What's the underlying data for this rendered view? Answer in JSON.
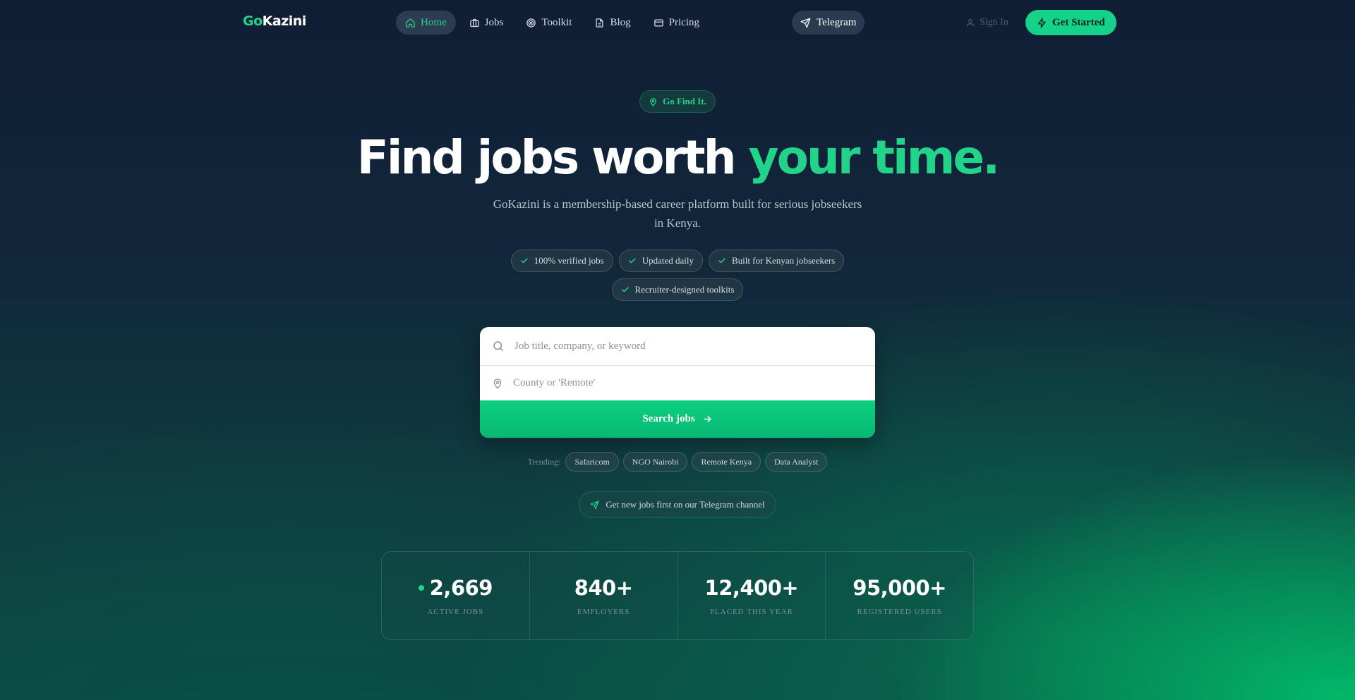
{
  "brand": {
    "logo_prefix": "Go",
    "logo_suffix": "Kazini"
  },
  "nav": {
    "links": [
      {
        "label": "Home",
        "icon": "home-icon",
        "active": true
      },
      {
        "label": "Jobs",
        "icon": "briefcase-icon"
      },
      {
        "label": "Toolkit",
        "icon": "target-icon"
      },
      {
        "label": "Blog",
        "icon": "document-icon"
      },
      {
        "label": "Pricing",
        "icon": "credit-card-icon"
      }
    ],
    "telegram": "Telegram",
    "sign_in": "Sign In",
    "get_started": "Get Started"
  },
  "hero": {
    "badge": "Go Find It.",
    "headline_main": "Find jobs worth ",
    "headline_accent": "your time.",
    "subtitle": "GoKazini is a membership-based career platform built for serious jobseekers in Kenya.",
    "features": [
      "100% verified jobs",
      "Updated daily",
      "Built for Kenyan jobseekers",
      "Recruiter-designed toolkits"
    ]
  },
  "search": {
    "keyword_placeholder": "Job title, company, or keyword",
    "location_placeholder": "County or 'Remote'",
    "button": "Search jobs"
  },
  "trending": {
    "label": "Trending:",
    "items": [
      "Safaricom",
      "NGO Nairobi",
      "Remote Kenya",
      "Data Analyst"
    ]
  },
  "telegram_cta": "Get new jobs first on our Telegram channel",
  "stats": [
    {
      "value": "2,669",
      "label": "ACTIVE JOBS"
    },
    {
      "value": "840+",
      "label": "EMPLOYERS"
    },
    {
      "value": "12,400+",
      "label": "PLACED THIS YEAR"
    },
    {
      "value": "95,000+",
      "label": "REGISTERED USERS"
    }
  ],
  "colors": {
    "accent": "#22d38a",
    "button": "#14d28a"
  }
}
